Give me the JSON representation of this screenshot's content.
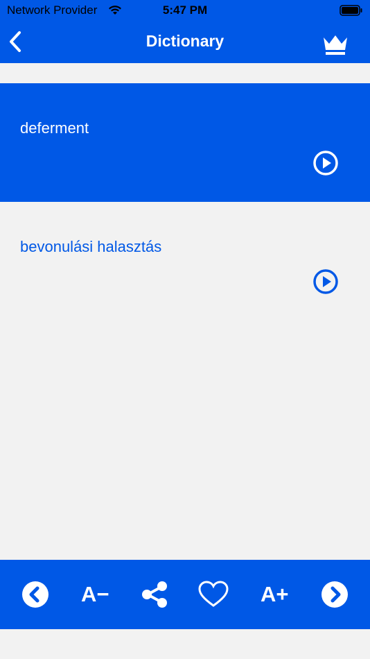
{
  "status_bar": {
    "carrier": "Network Provider",
    "time": "5:47 PM"
  },
  "nav": {
    "title": "Dictionary",
    "back_icon": "chevron-left-icon",
    "premium_icon": "crown-icon"
  },
  "entry": {
    "term": "deferment",
    "translation": "bevonulási halasztás"
  },
  "toolbar": {
    "decrease_font_label": "A−",
    "increase_font_label": "A+",
    "icons": [
      "chevron-left-circle-icon",
      "share-icon",
      "heart-icon",
      "chevron-right-circle-icon"
    ]
  },
  "colors": {
    "brand": "#0058e6",
    "background": "#f2f2f2",
    "on_brand": "#ffffff"
  }
}
